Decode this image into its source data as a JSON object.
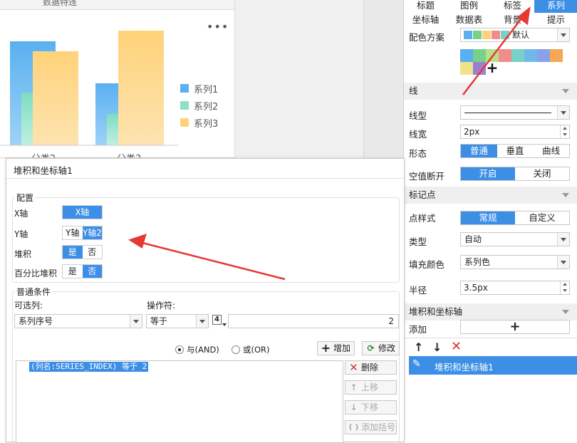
{
  "chart": {
    "title_fragment": "数据特连",
    "more_label": "•••",
    "legend": [
      "系列1",
      "系列2",
      "系列3"
    ],
    "category_fragments": [
      "分类2",
      "分类3"
    ],
    "colors": [
      "#5ab0f0",
      "#8ee0c8",
      "#ffd27a"
    ]
  },
  "prop_panel": {
    "tabs_row1": [
      {
        "label": "标题",
        "active": false
      },
      {
        "label": "图例",
        "active": false
      },
      {
        "label": "标签",
        "active": false
      },
      {
        "label": "系列",
        "active": true
      }
    ],
    "tabs_row2": [
      {
        "label": "坐标轴",
        "active": false
      },
      {
        "label": "数据表",
        "active": false
      },
      {
        "label": "背景",
        "active": false
      },
      {
        "label": "提示",
        "active": false
      }
    ],
    "color_scheme_label": "配色方案",
    "color_scheme_value": "默认",
    "color_scheme_swatches": [
      "#5ab0f0",
      "#77d18a",
      "#ffd27a",
      "#f08c8c",
      "#77d1c8"
    ],
    "palette_swatches": [
      "#5ab0f0",
      "#77d18a",
      "#b6e08a",
      "#f08c8c",
      "#77d1c8",
      "#6fb8e8",
      "#8aa0e8",
      "#f5a852",
      "#f0e28a",
      "#9b7fd1"
    ],
    "add_color_glyph": "+",
    "line_section": "线",
    "line_type_label": "线型",
    "line_width_label": "线宽",
    "line_width_value": "2px",
    "shape_label": "形态",
    "shape_options": [
      "普通",
      "垂直",
      "曲线"
    ],
    "null_break_label": "空值断开",
    "null_break_options": [
      "开启",
      "关闭"
    ],
    "marker_section": "标记点",
    "point_style_label": "点样式",
    "point_style_options": [
      "常规",
      "自定义"
    ],
    "type_label": "类型",
    "type_value": "自动",
    "fill_label": "填充颜色",
    "fill_value": "系列色",
    "radius_label": "半径",
    "radius_value": "3.5px",
    "stack_section": "堆积和坐标轴",
    "add_label": "添加",
    "add_glyph": "+",
    "list_item": "堆积和坐标轴1"
  },
  "dialog": {
    "title": "堆积和坐标轴1",
    "config_legend": "配置",
    "x_axis_label": "X轴",
    "x_axis_options": [
      "X轴"
    ],
    "y_axis_label": "Y轴",
    "y_axis_options": [
      "Y轴",
      "Y轴2"
    ],
    "stack_label": "堆积",
    "stack_options": [
      "是",
      "否"
    ],
    "percent_stack_label": "百分比堆积",
    "percent_stack_options": [
      "是",
      "否"
    ],
    "condition_legend": "普通条件",
    "column_label": "可选列:",
    "column_value": "系列序号",
    "operator_label": "操作符:",
    "operator_value": "等于",
    "value_type_glyph": "4",
    "value": "2",
    "radio_and": "与(AND)",
    "radio_or": "或(OR)",
    "add_button": "增加",
    "modify_button": "修改",
    "condition_text": "(列名:SERIES_INDEX) 等于 2",
    "delete_button": "删除",
    "up_button": "上移",
    "down_button": "下移",
    "bracket_button": "添加括号"
  }
}
